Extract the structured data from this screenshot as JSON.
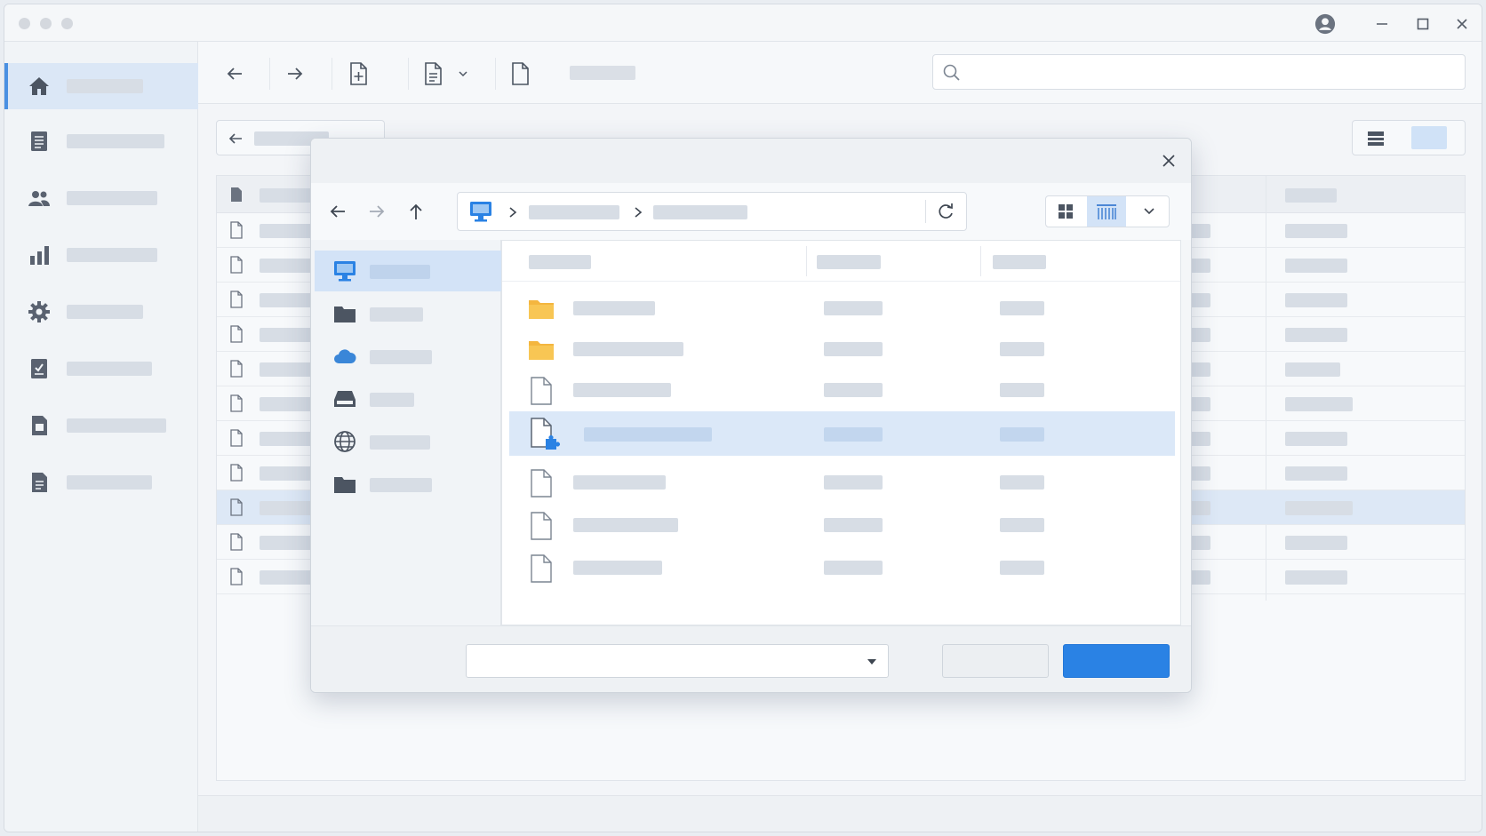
{
  "app": {
    "accent": "#2a82e4",
    "selection": "#dbe8f8"
  },
  "titlebar": {
    "controls": [
      "profile-icon",
      "minimize-icon",
      "maximize-icon",
      "close-icon"
    ]
  },
  "sidebar": {
    "items": [
      "home-icon",
      "list-icon",
      "users-icon",
      "chart-icon",
      "gear-icon",
      "tasks-icon",
      "document-icon",
      "notes-icon"
    ]
  },
  "toolbar": {
    "icons": [
      "arrow-left-icon",
      "arrow-right-icon",
      "new-file-icon",
      "document-menu-icon",
      "file-icon"
    ],
    "search": {
      "placeholder": ""
    }
  },
  "dialog": {
    "nav": {
      "icons": [
        "arrow-left-icon",
        "arrow-right-icon",
        "arrow-up-icon",
        "refresh-icon"
      ]
    },
    "places": [
      "computer-icon",
      "folder-icon",
      "cloud-icon",
      "drive-icon",
      "globe-icon",
      "folder-icon"
    ],
    "files": [
      {
        "type": "folder"
      },
      {
        "type": "folder"
      },
      {
        "type": "file"
      },
      {
        "type": "extension",
        "selected": true
      },
      {
        "type": "file"
      },
      {
        "type": "file"
      },
      {
        "type": "file"
      }
    ],
    "footer": {
      "filetype_value": "",
      "cancel_label": "",
      "open_label": ""
    }
  }
}
